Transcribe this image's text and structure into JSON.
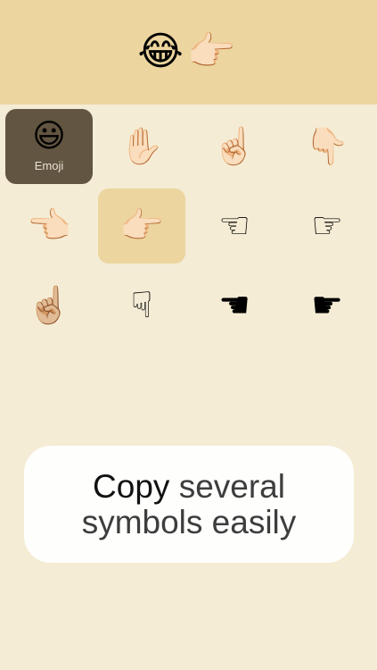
{
  "copy_bar": {
    "copied_text": "😂👉🏻"
  },
  "grid": {
    "category": {
      "icon": "😃",
      "label": "Emoji"
    },
    "symbols": [
      "✋🏻",
      "☝🏻",
      "👇🏻",
      "👈🏻",
      "👉🏻",
      "☜",
      "☞",
      "☝🏼",
      "☟",
      "☚",
      "☛"
    ],
    "selected": "👉🏻"
  },
  "caption": {
    "strong": "Copy",
    "light_1": "several",
    "light_2": "symbols easily"
  },
  "colors": {
    "background": "#f5ecd5",
    "accent": "#ecd59f",
    "category_bg": "#625541",
    "card_bg": "#fefefd"
  }
}
